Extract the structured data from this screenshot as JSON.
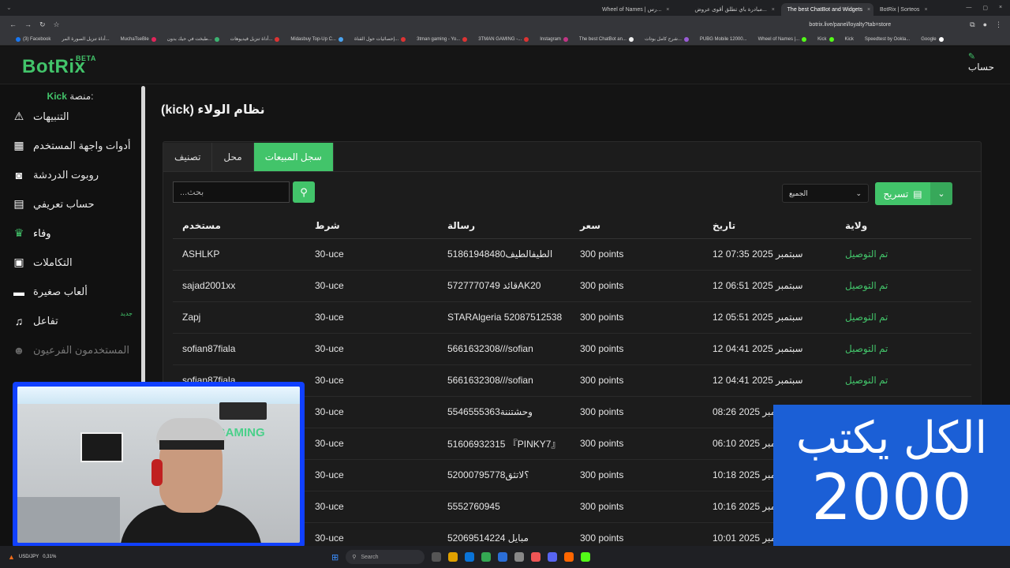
{
  "browser": {
    "tabs": [
      {
        "label": "Wheel of Names | رس..."
      },
      {
        "label": "مبادرة باي تطلق أقوى عروض..."
      },
      {
        "label": "The best ChatBot and Widgets",
        "active": true
      },
      {
        "label": "BotRix | Sorteos"
      }
    ],
    "url": "botrix.live/panel/loyalty?tab=store",
    "bookmarks": [
      "(3) Facebook",
      "أداة تنزيل الصورة المر...",
      "MuchaTseBle",
      "طبخت في حيك بدون...",
      "أداة تنزيل فيديوهات...",
      "Midasbuy Top-Up C...",
      "إحصائيات حول القناة...",
      "3tman gaming - Yo...",
      "3TMAN GAMING -...",
      "Instagram",
      "The best ChatBot an...",
      "شرح كامل بوتات...",
      "PUBG Mobile 12000...",
      "Wheel of Names |...",
      "Kick",
      "Kick",
      "Speedtest by Ookla...",
      "Google"
    ]
  },
  "app": {
    "logo": "BotRix",
    "logo_badge": "BETA",
    "account_label": "حساب",
    "platform_label": "منصة:",
    "platform_name": "Kick",
    "sidebar": [
      {
        "label": "التنبيهات",
        "icon": "warning-icon"
      },
      {
        "label": "أدوات واجهة المستخدم",
        "icon": "widgets-icon"
      },
      {
        "label": "روبوت الدردشة",
        "icon": "robot-icon"
      },
      {
        "label": "حساب تعريفي",
        "icon": "id-card-icon"
      },
      {
        "label": "وفاء",
        "icon": "trophy-icon",
        "active": true
      },
      {
        "label": "التكاملات",
        "icon": "integration-icon"
      },
      {
        "label": "ألعاب صغيرة",
        "icon": "gamepad-icon"
      },
      {
        "label": "تفاعل",
        "icon": "music-icon",
        "badge": "جديد"
      },
      {
        "label": "المستخدمون الفرعيون",
        "icon": "users-icon",
        "muted": true
      }
    ],
    "page_title": "نظام الولاء (kick)",
    "tabs": [
      "سجل المبيعات",
      "محل",
      "تصنيف"
    ],
    "search_placeholder": "بحث...",
    "filter_value": "الجميع",
    "export_label": "تسريح",
    "columns": {
      "user": "مستخدم",
      "condition": "شرط",
      "message": "رسالة",
      "price": "سعر",
      "date": "تاريخ",
      "state": "ولاية"
    },
    "rows": [
      {
        "user": "ASHLKP",
        "condition": "30-uce",
        "message": "51861948480الطيفالطيف",
        "price": "300 points",
        "date": "12 سبتمبر 2025 07:35",
        "state": "تم التوصيل"
      },
      {
        "user": "sajad2001xx",
        "condition": "30-uce",
        "message": "5727770749 قائدAK20",
        "price": "300 points",
        "date": "12 سبتمبر 2025 06:51",
        "state": "تم التوصيل"
      },
      {
        "user": "Zapj",
        "condition": "30-uce",
        "message": "STARAlgeria 52087512538",
        "price": "300 points",
        "date": "12 سبتمبر 2025 05:51",
        "state": "تم التوصيل"
      },
      {
        "user": "sofian87fiala",
        "condition": "30-uce",
        "message": "5661632308///sofian",
        "price": "300 points",
        "date": "12 سبتمبر 2025 04:41",
        "state": "تم التوصيل"
      },
      {
        "user": "sofian87fiala",
        "condition": "30-uce",
        "message": "5661632308///sofian",
        "price": "300 points",
        "date": "12 سبتمبر 2025 04:41",
        "state": "تم التوصيل"
      },
      {
        "user": "",
        "condition": "30-uce",
        "message": "5546555363وحشتننة",
        "price": "300 points",
        "date": "مبر 2025 08:26",
        "state": ""
      },
      {
        "user": "",
        "condition": "30-uce",
        "message": "51606932315 『PINKY7』",
        "price": "300 points",
        "date": "مبر 2025 06:10",
        "state": ""
      },
      {
        "user": "",
        "condition": "30-uce",
        "message": "52000795778؟لاتثق",
        "price": "300 points",
        "date": "مبر 2025 10:18",
        "state": ""
      },
      {
        "user": "",
        "condition": "30-uce",
        "message": "5552760945",
        "price": "300 points",
        "date": "مبر 2025 10:16",
        "state": ""
      },
      {
        "user": "",
        "condition": "30-uce",
        "message": "52069514224 مبايل",
        "price": "300 points",
        "date": "مبر 2025 10:01",
        "state": ""
      }
    ]
  },
  "webcam": {
    "wall_text": "GAMING"
  },
  "caption": {
    "line1": "الكل يكتب",
    "line2": "2000"
  },
  "taskbar": {
    "ticker_label": "USD/JPY",
    "ticker_value": "0,31%",
    "search_placeholder": "Search"
  },
  "colors": {
    "accent": "#42c46a",
    "caption_bg": "#1b5fd6",
    "webcam_frame": "#1040ff"
  }
}
